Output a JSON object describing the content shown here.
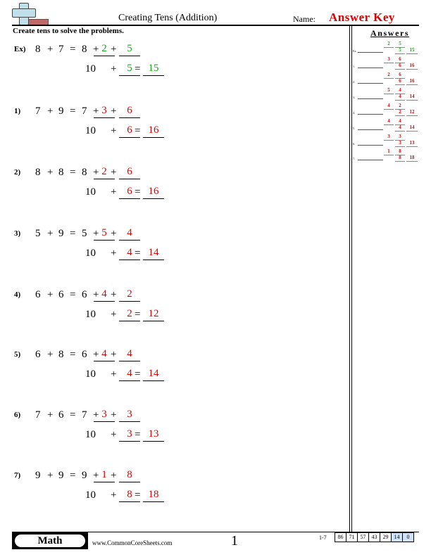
{
  "header": {
    "title": "Creating Tens (Addition)",
    "name_label": "Name:",
    "name_value": "Answer Key",
    "logo_icon": "plus-minus-logo-icon"
  },
  "instructions": "Create tens to solve the problems.",
  "colors": {
    "example_answer": "#17a817",
    "answer": "#e00000",
    "name_value": "#e00000",
    "score_highlight": "#d0e2f8"
  },
  "problems": [
    {
      "label": "Ex)",
      "a": "8",
      "b": "7",
      "first": "8",
      "split1": "2",
      "split2": "5",
      "ten": "10",
      "add": "5",
      "sum": "15",
      "example": true
    },
    {
      "label": "1)",
      "a": "7",
      "b": "9",
      "first": "7",
      "split1": "3",
      "split2": "6",
      "ten": "10",
      "add": "6",
      "sum": "16"
    },
    {
      "label": "2)",
      "a": "8",
      "b": "8",
      "first": "8",
      "split1": "2",
      "split2": "6",
      "ten": "10",
      "add": "6",
      "sum": "16"
    },
    {
      "label": "3)",
      "a": "5",
      "b": "9",
      "first": "5",
      "split1": "5",
      "split2": "4",
      "ten": "10",
      "add": "4",
      "sum": "14"
    },
    {
      "label": "4)",
      "a": "6",
      "b": "6",
      "first": "6",
      "split1": "4",
      "split2": "2",
      "ten": "10",
      "add": "2",
      "sum": "12"
    },
    {
      "label": "5)",
      "a": "6",
      "b": "8",
      "first": "6",
      "split1": "4",
      "split2": "4",
      "ten": "10",
      "add": "4",
      "sum": "14"
    },
    {
      "label": "6)",
      "a": "7",
      "b": "6",
      "first": "7",
      "split1": "3",
      "split2": "3",
      "ten": "10",
      "add": "3",
      "sum": "13"
    },
    {
      "label": "7)",
      "a": "9",
      "b": "9",
      "first": "9",
      "split1": "1",
      "split2": "8",
      "ten": "10",
      "add": "8",
      "sum": "18"
    }
  ],
  "operators": {
    "plus": "+",
    "equals": "="
  },
  "answers_panel": {
    "title": "Answers",
    "rows": [
      {
        "label": "Ex.",
        "split1": "2",
        "split2": "5",
        "add": "5",
        "sum": "15"
      },
      {
        "label": "1.",
        "split1": "3",
        "split2": "6",
        "add": "6",
        "sum": "16"
      },
      {
        "label": "2.",
        "split1": "2",
        "split2": "6",
        "add": "6",
        "sum": "16"
      },
      {
        "label": "3.",
        "split1": "5",
        "split2": "4",
        "add": "4",
        "sum": "14"
      },
      {
        "label": "4.",
        "split1": "4",
        "split2": "2",
        "add": "2",
        "sum": "12"
      },
      {
        "label": "5.",
        "split1": "4",
        "split2": "4",
        "add": "4",
        "sum": "14"
      },
      {
        "label": "6.",
        "split1": "3",
        "split2": "3",
        "add": "3",
        "sum": "13"
      },
      {
        "label": "7.",
        "split1": "1",
        "split2": "8",
        "add": "8",
        "sum": "18"
      }
    ]
  },
  "footer": {
    "subject": "Math",
    "site": "www.CommonCoreSheets.com",
    "page": "1",
    "score_label": "1-7",
    "scores": [
      "86",
      "71",
      "57",
      "43",
      "29",
      "14",
      "0"
    ],
    "highlighted_scores": [
      "14",
      "0"
    ]
  }
}
